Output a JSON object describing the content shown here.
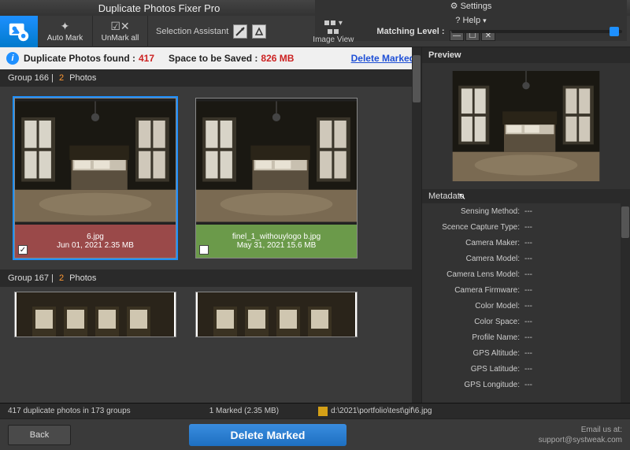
{
  "titlebar": {
    "title": "Duplicate Photos Fixer Pro",
    "settings": "Settings",
    "help": "? Help",
    "dropdown": "▾"
  },
  "toolbar": {
    "automark": "Auto Mark",
    "unmarkall": "UnMark all",
    "selection_assistant": "Selection Assistant",
    "image_view": "Image View",
    "matching_level": "Matching Level :"
  },
  "infobar": {
    "found_label": "Duplicate Photos found :",
    "found_count": "417",
    "space_label": "Space to be Saved :",
    "space_value": "826 MB",
    "delete_marked": "Delete Marked"
  },
  "groups": [
    {
      "header_prefix": "Group 166",
      "sep": "|",
      "count": "2",
      "suffix": "Photos",
      "items": [
        {
          "name": "6.jpg",
          "meta": "Jun 01, 2021    2.35 MB",
          "checked": true,
          "footer": "red"
        },
        {
          "name": "finel_1_withouylogo b.jpg",
          "meta": "May 31, 2021    15.6 MB",
          "checked": false,
          "footer": "green"
        }
      ]
    },
    {
      "header_prefix": "Group 167",
      "sep": "|",
      "count": "2",
      "suffix": "Photos"
    }
  ],
  "right": {
    "preview_label": "Preview",
    "metadata_label": "Metadata",
    "cursor_glyph": "↖"
  },
  "metadata": [
    {
      "k": "Sensing Method:",
      "v": "---"
    },
    {
      "k": "Scence Capture Type:",
      "v": "---"
    },
    {
      "k": "Camera Maker:",
      "v": "---"
    },
    {
      "k": "Camera Model:",
      "v": "---"
    },
    {
      "k": "Camera Lens Model:",
      "v": "---"
    },
    {
      "k": "Camera Firmware:",
      "v": "---"
    },
    {
      "k": "Color Model:",
      "v": "---"
    },
    {
      "k": "Color Space:",
      "v": "---"
    },
    {
      "k": "Profile Name:",
      "v": "---"
    },
    {
      "k": "GPS Altitude:",
      "v": "---"
    },
    {
      "k": "GPS Latitude:",
      "v": "---"
    },
    {
      "k": "GPS Longitude:",
      "v": "---"
    }
  ],
  "status": {
    "summary": "417 duplicate photos in 173 groups",
    "marked": "1 Marked (2.35 MB)",
    "path": "d:\\2021\\portfolio\\test\\gif\\6.jpg"
  },
  "bottom": {
    "back": "Back",
    "delete_marked": "Delete Marked",
    "email_label": "Email us at:",
    "email_value": "support@systweak.com"
  },
  "icons": {
    "gear": "⚙",
    "check": "✓"
  }
}
